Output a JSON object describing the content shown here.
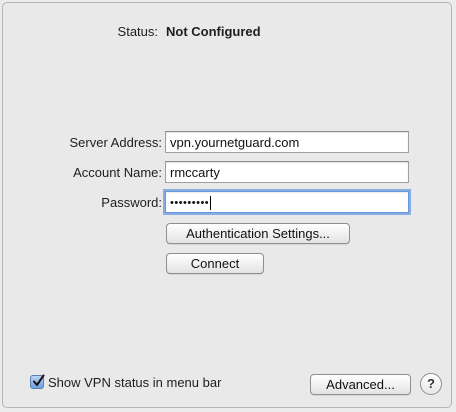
{
  "status": {
    "label": "Status:",
    "value": "Not Configured"
  },
  "form": {
    "server_address": {
      "label": "Server Address:",
      "value": "vpn.yournetguard.com"
    },
    "account_name": {
      "label": "Account Name:",
      "value": "rmccarty"
    },
    "password": {
      "label": "Password:",
      "masked_value": "•••••••••"
    }
  },
  "buttons": {
    "authentication_settings": "Authentication Settings...",
    "connect": "Connect",
    "advanced": "Advanced...",
    "help": "?"
  },
  "show_vpn_status": {
    "label": "Show VPN status in menu bar",
    "checked": true
  },
  "colors": {
    "background": "#e9e9e9",
    "focus_ring": "#86aee6",
    "checkbox_fill": "#6e9fe0"
  }
}
